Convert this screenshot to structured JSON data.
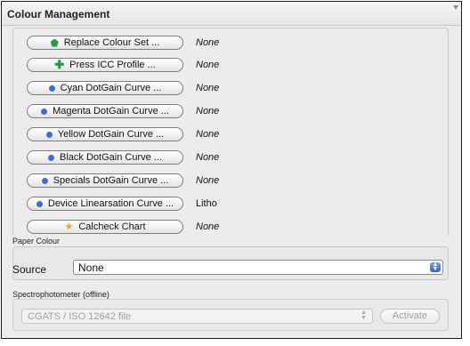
{
  "panel": {
    "title": "Colour Management"
  },
  "buttons": [
    {
      "label": "Replace Colour Set ...",
      "icon": "green-pentagon-icon",
      "value": "None"
    },
    {
      "label": "Press ICC Profile ...",
      "icon": "green-plus-icon",
      "value": "None"
    },
    {
      "label": "Cyan DotGain Curve ...",
      "icon": "blue-dot-icon",
      "value": "None"
    },
    {
      "label": "Magenta DotGain Curve ...",
      "icon": "blue-dot-icon",
      "value": "None"
    },
    {
      "label": "Yellow DotGain Curve ...",
      "icon": "blue-dot-icon",
      "value": "None"
    },
    {
      "label": "Black DotGain Curve ...",
      "icon": "blue-dot-icon",
      "value": "None"
    },
    {
      "label": "Specials DotGain Curve ...",
      "icon": "blue-dot-icon",
      "value": "None"
    },
    {
      "label": "Device Linearsation Curve ...",
      "icon": "blue-dot-icon",
      "value": "Litho"
    },
    {
      "label": "Calcheck Chart",
      "icon": "orange-star-icon",
      "value": "None"
    }
  ],
  "paper_colour": {
    "section_label": "Paper Colour",
    "source_label": "Source",
    "source_value": "None"
  },
  "spectro": {
    "section_label": "Spectrophotometer (offline)",
    "format_value": "CGATS / ISO 12642 file",
    "activate_label": "Activate"
  },
  "colors": {
    "green": "#16a43e",
    "blue_dot": "#3b6fd8",
    "star": "#f4a21a",
    "stepper_blue": "#2f66d1"
  }
}
